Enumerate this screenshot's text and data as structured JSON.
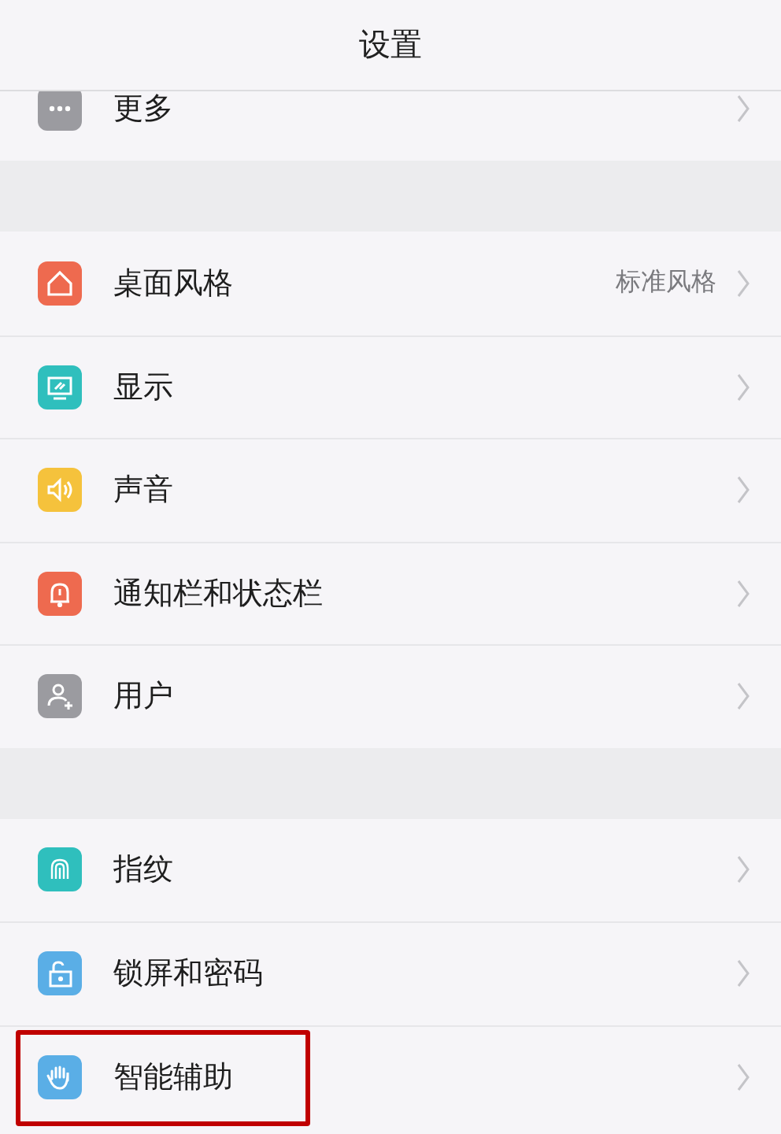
{
  "header": {
    "title": "设置"
  },
  "sections": [
    {
      "items": [
        {
          "label": "更多",
          "color": "#9b9ba0",
          "highlighted": false
        }
      ]
    },
    {
      "items": [
        {
          "label": "桌面风格",
          "value": "标准风格",
          "color": "#ee6a4f",
          "highlighted": false
        },
        {
          "label": "显示",
          "color": "#2fbfbd",
          "highlighted": false
        },
        {
          "label": "声音",
          "color": "#f5c23c",
          "highlighted": false
        },
        {
          "label": "通知栏和状态栏",
          "color": "#ee6a4f",
          "highlighted": false
        },
        {
          "label": "用户",
          "color": "#9b9ba0",
          "highlighted": false
        }
      ]
    },
    {
      "items": [
        {
          "label": "指纹",
          "color": "#2fbfbd",
          "highlighted": false
        },
        {
          "label": "锁屏和密码",
          "color": "#5aaee6",
          "highlighted": false
        },
        {
          "label": "智能辅助",
          "color": "#5aaee6",
          "highlighted": true
        }
      ]
    }
  ]
}
